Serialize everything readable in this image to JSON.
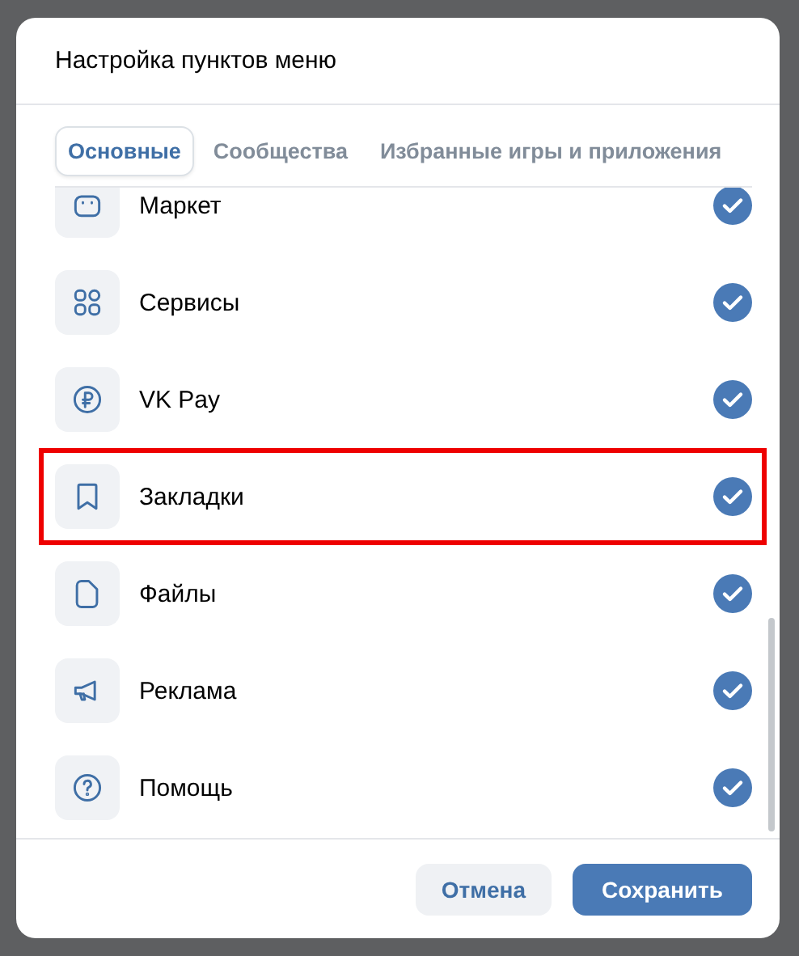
{
  "dialog": {
    "title": "Настройка пунктов меню"
  },
  "tabs": [
    {
      "label": "Основные",
      "selected": true
    },
    {
      "label": "Сообщества",
      "selected": false
    },
    {
      "label": "Избранные игры и приложения",
      "selected": false
    }
  ],
  "items": [
    {
      "label": "Маркет",
      "checked": true,
      "highlighted": false
    },
    {
      "label": "Сервисы",
      "checked": true,
      "highlighted": false
    },
    {
      "label": "VK Pay",
      "checked": true,
      "highlighted": false
    },
    {
      "label": "Закладки",
      "checked": true,
      "highlighted": true
    },
    {
      "label": "Файлы",
      "checked": true,
      "highlighted": false
    },
    {
      "label": "Реклама",
      "checked": true,
      "highlighted": false
    },
    {
      "label": "Помощь",
      "checked": true,
      "highlighted": false
    }
  ],
  "buttons": [
    {
      "label": "Отмена",
      "kind": "secondary"
    },
    {
      "label": "Сохранить",
      "kind": "primary"
    }
  ]
}
